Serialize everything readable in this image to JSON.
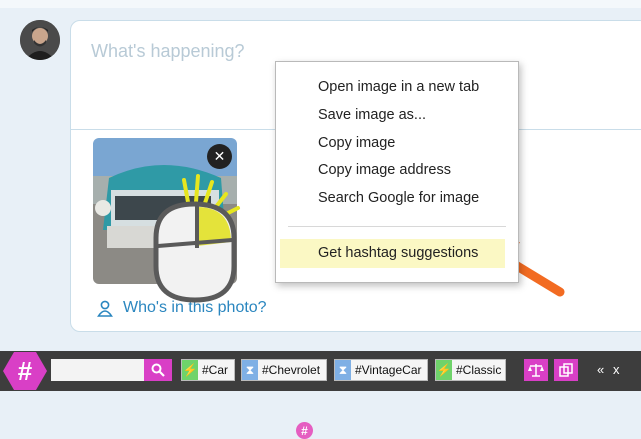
{
  "composer": {
    "placeholder": "What's happening?",
    "who_label": "Who's in this photo?"
  },
  "context_menu": {
    "items": [
      "Open image in a new tab",
      "Save image as...",
      "Copy image",
      "Copy image address",
      "Search Google for image"
    ],
    "hashtag_item": "Get hashtag suggestions"
  },
  "toolbar": {
    "logo": "#",
    "search_value": "",
    "tags": [
      {
        "label": "#Car",
        "icon": "lightning-icon",
        "color": "#6fd36a"
      },
      {
        "label": "#Chevrolet",
        "icon": "hourglass-icon",
        "color": "#7fb0e5"
      },
      {
        "label": "#VintageCar",
        "icon": "hourglass-icon",
        "color": "#7fb0e5"
      },
      {
        "label": "#Classic",
        "icon": "lightning-icon",
        "color": "#6fd36a"
      }
    ],
    "collapse": "«",
    "close": "x"
  },
  "colors": {
    "accent": "#d93fc6",
    "link": "#2a86bf",
    "arrow": "#f26b22"
  }
}
